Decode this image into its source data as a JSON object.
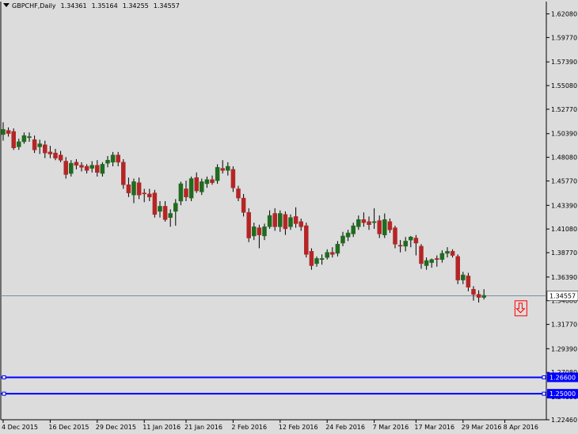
{
  "header": {
    "symbol": "GBPCHF,Daily",
    "open": "1.34361",
    "high": "1.35164",
    "low": "1.34255",
    "close": "1.34557"
  },
  "colors": {
    "background": "#dcdcdc",
    "bull": "#1f6b1f",
    "bear": "#b52525",
    "current_line": "#7f8aa0",
    "level_line": "#0000ff",
    "arrow": "#ff0000"
  },
  "chart_data": {
    "type": "candlestick",
    "ylim": [
      1.2246,
      1.6328
    ],
    "y_ticks": [
      "1.62080",
      "1.59770",
      "1.57390",
      "1.55080",
      "1.52770",
      "1.50390",
      "1.48080",
      "1.45770",
      "1.43390",
      "1.41080",
      "1.38770",
      "1.36390",
      "1.34080",
      "1.31770",
      "1.29390",
      "1.27080",
      "1.24690",
      "1.22460"
    ],
    "x_labels": [
      "4 Dec 2015",
      "16 Dec 2015",
      "29 Dec 2015",
      "11 Jan 2016",
      "21 Jan 2016",
      "2 Feb 2016",
      "12 Feb 2016",
      "24 Feb 2016",
      "7 Mar 2016",
      "17 Mar 2016",
      "29 Mar 2016",
      "8 Apr 2016"
    ],
    "x_label_index": [
      0,
      9,
      18,
      27,
      35,
      44,
      53,
      62,
      71,
      79,
      88,
      96
    ],
    "current_price": {
      "label": "1.34557",
      "value": 1.34557
    },
    "levels": [
      {
        "label": "1.26600",
        "value": 1.266
      },
      {
        "label": "1.25000",
        "value": 1.25
      }
    ],
    "arrow_marker": {
      "index": 99,
      "value": 1.333,
      "icon": "down-arrow-icon"
    },
    "candles": [
      {
        "o": 1.503,
        "h": 1.515,
        "l": 1.497,
        "c": 1.508
      },
      {
        "o": 1.507,
        "h": 1.51,
        "l": 1.501,
        "c": 1.504
      },
      {
        "o": 1.506,
        "h": 1.509,
        "l": 1.488,
        "c": 1.49
      },
      {
        "o": 1.491,
        "h": 1.499,
        "l": 1.488,
        "c": 1.496
      },
      {
        "o": 1.496,
        "h": 1.505,
        "l": 1.494,
        "c": 1.502
      },
      {
        "o": 1.5,
        "h": 1.505,
        "l": 1.496,
        "c": 1.501
      },
      {
        "o": 1.498,
        "h": 1.502,
        "l": 1.485,
        "c": 1.488
      },
      {
        "o": 1.491,
        "h": 1.498,
        "l": 1.484,
        "c": 1.494
      },
      {
        "o": 1.493,
        "h": 1.497,
        "l": 1.48,
        "c": 1.485
      },
      {
        "o": 1.486,
        "h": 1.492,
        "l": 1.48,
        "c": 1.484
      },
      {
        "o": 1.485,
        "h": 1.489,
        "l": 1.478,
        "c": 1.48
      },
      {
        "o": 1.483,
        "h": 1.487,
        "l": 1.476,
        "c": 1.478
      },
      {
        "o": 1.477,
        "h": 1.481,
        "l": 1.46,
        "c": 1.464
      },
      {
        "o": 1.465,
        "h": 1.478,
        "l": 1.462,
        "c": 1.475
      },
      {
        "o": 1.476,
        "h": 1.479,
        "l": 1.469,
        "c": 1.473
      },
      {
        "o": 1.473,
        "h": 1.476,
        "l": 1.467,
        "c": 1.471
      },
      {
        "o": 1.472,
        "h": 1.474,
        "l": 1.465,
        "c": 1.468
      },
      {
        "o": 1.47,
        "h": 1.477,
        "l": 1.466,
        "c": 1.473
      },
      {
        "o": 1.473,
        "h": 1.478,
        "l": 1.462,
        "c": 1.466
      },
      {
        "o": 1.465,
        "h": 1.476,
        "l": 1.462,
        "c": 1.474
      },
      {
        "o": 1.475,
        "h": 1.482,
        "l": 1.471,
        "c": 1.478
      },
      {
        "o": 1.476,
        "h": 1.486,
        "l": 1.472,
        "c": 1.483
      },
      {
        "o": 1.483,
        "h": 1.486,
        "l": 1.472,
        "c": 1.476
      },
      {
        "o": 1.476,
        "h": 1.479,
        "l": 1.45,
        "c": 1.454
      },
      {
        "o": 1.454,
        "h": 1.461,
        "l": 1.442,
        "c": 1.446
      },
      {
        "o": 1.444,
        "h": 1.46,
        "l": 1.436,
        "c": 1.457
      },
      {
        "o": 1.456,
        "h": 1.461,
        "l": 1.44,
        "c": 1.444
      },
      {
        "o": 1.446,
        "h": 1.45,
        "l": 1.437,
        "c": 1.445
      },
      {
        "o": 1.445,
        "h": 1.45,
        "l": 1.438,
        "c": 1.442
      },
      {
        "o": 1.446,
        "h": 1.449,
        "l": 1.422,
        "c": 1.425
      },
      {
        "o": 1.428,
        "h": 1.438,
        "l": 1.422,
        "c": 1.433
      },
      {
        "o": 1.433,
        "h": 1.438,
        "l": 1.418,
        "c": 1.42
      },
      {
        "o": 1.422,
        "h": 1.43,
        "l": 1.413,
        "c": 1.426
      },
      {
        "o": 1.428,
        "h": 1.44,
        "l": 1.414,
        "c": 1.436
      },
      {
        "o": 1.438,
        "h": 1.457,
        "l": 1.434,
        "c": 1.455
      },
      {
        "o": 1.45,
        "h": 1.458,
        "l": 1.438,
        "c": 1.442
      },
      {
        "o": 1.441,
        "h": 1.462,
        "l": 1.438,
        "c": 1.46
      },
      {
        "o": 1.461,
        "h": 1.466,
        "l": 1.446,
        "c": 1.448
      },
      {
        "o": 1.447,
        "h": 1.46,
        "l": 1.444,
        "c": 1.457
      },
      {
        "o": 1.455,
        "h": 1.462,
        "l": 1.451,
        "c": 1.459
      },
      {
        "o": 1.459,
        "h": 1.463,
        "l": 1.454,
        "c": 1.456
      },
      {
        "o": 1.458,
        "h": 1.474,
        "l": 1.455,
        "c": 1.471
      },
      {
        "o": 1.47,
        "h": 1.478,
        "l": 1.465,
        "c": 1.468
      },
      {
        "o": 1.468,
        "h": 1.476,
        "l": 1.463,
        "c": 1.472
      },
      {
        "o": 1.469,
        "h": 1.472,
        "l": 1.447,
        "c": 1.451
      },
      {
        "o": 1.45,
        "h": 1.453,
        "l": 1.438,
        "c": 1.441
      },
      {
        "o": 1.441,
        "h": 1.445,
        "l": 1.423,
        "c": 1.427
      },
      {
        "o": 1.427,
        "h": 1.431,
        "l": 1.398,
        "c": 1.402
      },
      {
        "o": 1.404,
        "h": 1.417,
        "l": 1.4,
        "c": 1.413
      },
      {
        "o": 1.412,
        "h": 1.415,
        "l": 1.392,
        "c": 1.405
      },
      {
        "o": 1.404,
        "h": 1.416,
        "l": 1.4,
        "c": 1.413
      },
      {
        "o": 1.413,
        "h": 1.429,
        "l": 1.411,
        "c": 1.424
      },
      {
        "o": 1.426,
        "h": 1.431,
        "l": 1.409,
        "c": 1.413
      },
      {
        "o": 1.413,
        "h": 1.429,
        "l": 1.408,
        "c": 1.426
      },
      {
        "o": 1.425,
        "h": 1.428,
        "l": 1.405,
        "c": 1.411
      },
      {
        "o": 1.413,
        "h": 1.425,
        "l": 1.41,
        "c": 1.422
      },
      {
        "o": 1.423,
        "h": 1.432,
        "l": 1.412,
        "c": 1.416
      },
      {
        "o": 1.418,
        "h": 1.421,
        "l": 1.409,
        "c": 1.413
      },
      {
        "o": 1.414,
        "h": 1.417,
        "l": 1.383,
        "c": 1.386
      },
      {
        "o": 1.389,
        "h": 1.392,
        "l": 1.371,
        "c": 1.375
      },
      {
        "o": 1.377,
        "h": 1.384,
        "l": 1.374,
        "c": 1.382
      },
      {
        "o": 1.381,
        "h": 1.386,
        "l": 1.376,
        "c": 1.382
      },
      {
        "o": 1.383,
        "h": 1.391,
        "l": 1.381,
        "c": 1.388
      },
      {
        "o": 1.388,
        "h": 1.393,
        "l": 1.383,
        "c": 1.386
      },
      {
        "o": 1.387,
        "h": 1.399,
        "l": 1.384,
        "c": 1.396
      },
      {
        "o": 1.397,
        "h": 1.408,
        "l": 1.394,
        "c": 1.404
      },
      {
        "o": 1.403,
        "h": 1.41,
        "l": 1.399,
        "c": 1.407
      },
      {
        "o": 1.406,
        "h": 1.417,
        "l": 1.403,
        "c": 1.414
      },
      {
        "o": 1.413,
        "h": 1.424,
        "l": 1.41,
        "c": 1.42
      },
      {
        "o": 1.42,
        "h": 1.427,
        "l": 1.413,
        "c": 1.417
      },
      {
        "o": 1.418,
        "h": 1.423,
        "l": 1.41,
        "c": 1.415
      },
      {
        "o": 1.417,
        "h": 1.431,
        "l": 1.411,
        "c": 1.418
      },
      {
        "o": 1.419,
        "h": 1.424,
        "l": 1.402,
        "c": 1.406
      },
      {
        "o": 1.405,
        "h": 1.426,
        "l": 1.402,
        "c": 1.42
      },
      {
        "o": 1.418,
        "h": 1.421,
        "l": 1.407,
        "c": 1.41
      },
      {
        "o": 1.412,
        "h": 1.414,
        "l": 1.392,
        "c": 1.396
      },
      {
        "o": 1.395,
        "h": 1.4,
        "l": 1.388,
        "c": 1.394
      },
      {
        "o": 1.394,
        "h": 1.403,
        "l": 1.389,
        "c": 1.399
      },
      {
        "o": 1.4,
        "h": 1.404,
        "l": 1.393,
        "c": 1.403
      },
      {
        "o": 1.402,
        "h": 1.405,
        "l": 1.385,
        "c": 1.397
      },
      {
        "o": 1.394,
        "h": 1.396,
        "l": 1.372,
        "c": 1.377
      },
      {
        "o": 1.375,
        "h": 1.383,
        "l": 1.371,
        "c": 1.38
      },
      {
        "o": 1.378,
        "h": 1.382,
        "l": 1.373,
        "c": 1.381
      },
      {
        "o": 1.382,
        "h": 1.385,
        "l": 1.374,
        "c": 1.381
      },
      {
        "o": 1.381,
        "h": 1.39,
        "l": 1.378,
        "c": 1.387
      },
      {
        "o": 1.387,
        "h": 1.393,
        "l": 1.383,
        "c": 1.389
      },
      {
        "o": 1.389,
        "h": 1.391,
        "l": 1.383,
        "c": 1.385
      },
      {
        "o": 1.384,
        "h": 1.386,
        "l": 1.357,
        "c": 1.361
      },
      {
        "o": 1.361,
        "h": 1.369,
        "l": 1.357,
        "c": 1.366
      },
      {
        "o": 1.365,
        "h": 1.368,
        "l": 1.35,
        "c": 1.354
      },
      {
        "o": 1.352,
        "h": 1.355,
        "l": 1.341,
        "c": 1.347
      },
      {
        "o": 1.347,
        "h": 1.351,
        "l": 1.339,
        "c": 1.344
      },
      {
        "o": 1.344,
        "h": 1.352,
        "l": 1.342,
        "c": 1.346
      }
    ]
  }
}
